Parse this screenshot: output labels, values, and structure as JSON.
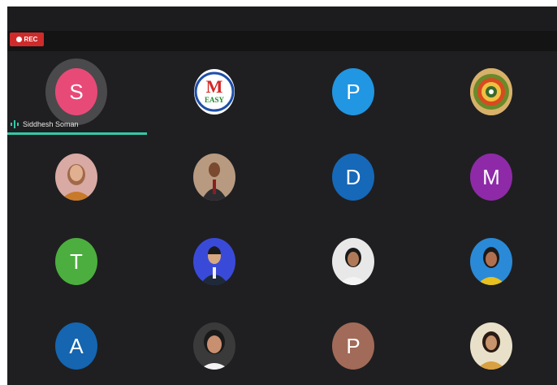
{
  "recording": {
    "label": "REC"
  },
  "active_speaker": {
    "name": "Siddhesh Soman"
  },
  "participants": [
    {
      "kind": "initial",
      "initial": "S",
      "color": "#e84a78",
      "icon": "avatar-initial-s"
    },
    {
      "kind": "logo",
      "logo_letter": "M",
      "logo_text": "EASY",
      "icon": "m-easy-logo"
    },
    {
      "kind": "initial",
      "initial": "P",
      "color": "#2196e3",
      "icon": "avatar-initial-p"
    },
    {
      "kind": "photo",
      "icon": "mandala-emblem"
    },
    {
      "kind": "photo",
      "icon": "woman-photo"
    },
    {
      "kind": "photo",
      "icon": "man-photo"
    },
    {
      "kind": "initial",
      "initial": "D",
      "color": "#1668b8",
      "icon": "avatar-initial-d"
    },
    {
      "kind": "initial",
      "initial": "M",
      "color": "#8e2aa8",
      "icon": "avatar-initial-m"
    },
    {
      "kind": "initial",
      "initial": "T",
      "color": "#4cae3e",
      "icon": "avatar-initial-t"
    },
    {
      "kind": "photo",
      "icon": "man-photo"
    },
    {
      "kind": "photo",
      "icon": "woman-photo"
    },
    {
      "kind": "photo",
      "icon": "woman-photo"
    },
    {
      "kind": "initial",
      "initial": "A",
      "color": "#1565b0",
      "icon": "avatar-initial-a"
    },
    {
      "kind": "photo",
      "icon": "woman-photo"
    },
    {
      "kind": "initial",
      "initial": "P",
      "color": "#a26a58",
      "icon": "avatar-initial-p"
    },
    {
      "kind": "photo",
      "icon": "woman-photo"
    }
  ]
}
